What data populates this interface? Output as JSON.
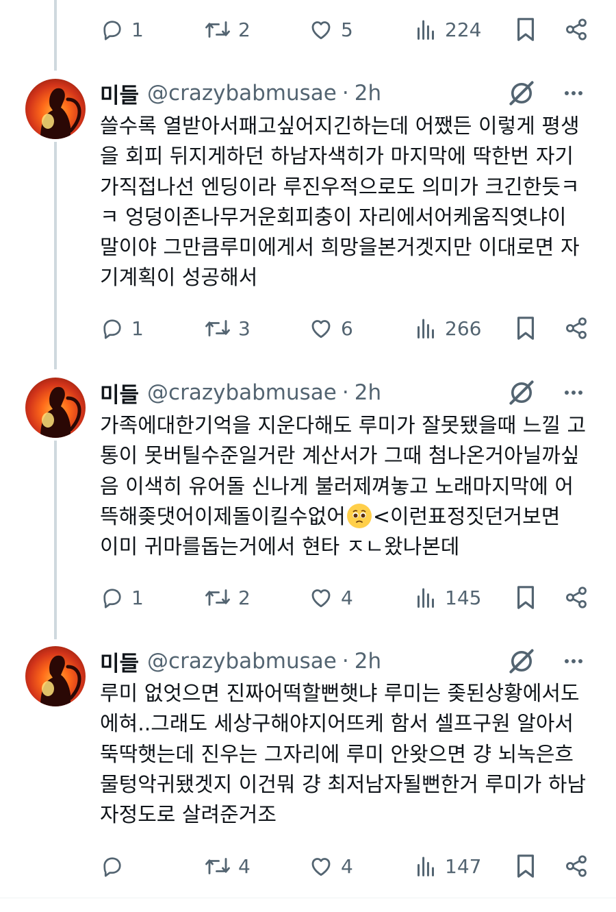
{
  "top_actions": {
    "replies": "1",
    "reposts": "2",
    "likes": "5",
    "views": "224"
  },
  "posts": [
    {
      "name": "미들",
      "handle": "@crazybabmusae",
      "separator": "·",
      "time": "2h",
      "lines": [
        "쓸수록 열받아서패고싶어지긴하는데 어쨌든 이렇게 평생",
        "을 회피 뒤지게하던 하남자색히가 마지막에 딱한번 자기",
        "가직접나선 엔딩이라 루진우적으로도 의미가 크긴한듯ㅋ",
        "ㅋ 엉덩이존나무거운회피충이 자리에서어케움직엿냐이",
        "말이야 그만큼루미에게서 희망을본거겟지만 이대로면 자",
        "기계획이 성공해서"
      ],
      "actions": {
        "replies": "1",
        "reposts": "3",
        "likes": "6",
        "views": "266"
      }
    },
    {
      "name": "미들",
      "handle": "@crazybabmusae",
      "separator": "·",
      "time": "2h",
      "lines": [
        "가족에대한기억을 지운다해도 루미가 잘못됐을때 느낄 고",
        "통이 못버틸수준일거란 계산서가 그때 첨나온거아닐까싶",
        "음 이색히 유어돌 신나게 불러제껴놓고 노래마지막에 어",
        "뜩해좆댓어이제돌이킬수없어",
        "이미 귀마를돕는거에서 현타 ㅈㄴ왔나본데"
      ],
      "emoji_line_tail": "<이런표정짓던거보면",
      "actions": {
        "replies": "1",
        "reposts": "2",
        "likes": "4",
        "views": "145"
      }
    },
    {
      "name": "미들",
      "handle": "@crazybabmusae",
      "separator": "·",
      "time": "2h",
      "lines": [
        "루미 없엇으면 진짜어떡할뻔햇냐 루미는 좆된상황에서도",
        "에혀..그래도 세상구해야지어뜨케 함서 셀프구원 알아서",
        "뚝딱햇는데 진우는 그자리에 루미 안왓으면 걍 뇌녹은흐",
        "물텅악귀됐겟지 이건뭐 걍 최저남자될뻔한거 루미가 하남",
        "자정도로 살려준거조"
      ],
      "actions": {
        "replies": "",
        "reposts": "4",
        "likes": "4",
        "views": "147"
      }
    }
  ],
  "icons": {
    "reply": "reply-icon",
    "repost": "repost-icon",
    "like": "like-icon",
    "views": "views-icon",
    "bookmark": "bookmark-icon",
    "share": "share-icon",
    "grok": "grok-icon",
    "more": "more-icon",
    "emoji": "pleading-face-emoji"
  },
  "colors": {
    "text": "#0f1419",
    "secondary": "#536471",
    "thread_line": "#cfd9de",
    "divider": "#eff3f4"
  }
}
